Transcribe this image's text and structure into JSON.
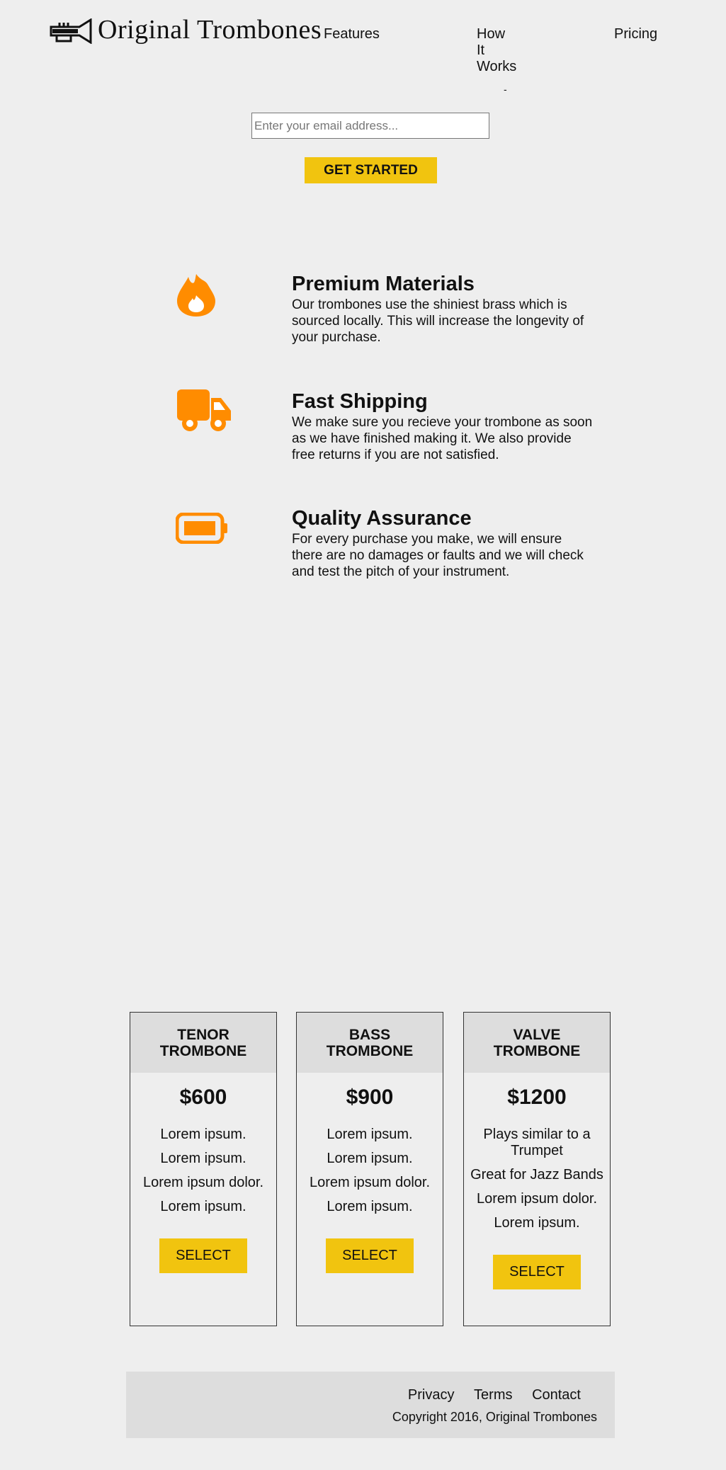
{
  "header": {
    "brand": "Original Trombones",
    "nav": [
      {
        "label": "Features"
      },
      {
        "label": "How It Works"
      },
      {
        "label": "Pricing"
      }
    ],
    "nav_marker": "-"
  },
  "hero": {
    "email_placeholder": "Enter your email address...",
    "email_value": "",
    "cta_label": "Get Started"
  },
  "features": [
    {
      "icon": "fire-icon",
      "title": "Premium Materials",
      "description": "Our trombones use the shiniest brass which is sourced locally. This will increase the longevity of your purchase."
    },
    {
      "icon": "truck-icon",
      "title": "Fast Shipping",
      "description": "We make sure you recieve your trombone as soon as we have finished making it. We also provide free returns if you are not satisfied."
    },
    {
      "icon": "battery-icon",
      "title": "Quality Assurance",
      "description": "For every purchase you make, we will ensure there are no damages or faults and we will check and test the pitch of your instrument."
    }
  ],
  "pricing": [
    {
      "name": "Tenor Trombone",
      "price": "$600",
      "features": [
        "Lorem ipsum.",
        "Lorem ipsum.",
        "Lorem ipsum dolor.",
        "Lorem ipsum."
      ],
      "button": "Select"
    },
    {
      "name": "Bass Trombone",
      "price": "$900",
      "features": [
        "Lorem ipsum.",
        "Lorem ipsum.",
        "Lorem ipsum dolor.",
        "Lorem ipsum."
      ],
      "button": "Select"
    },
    {
      "name": "Valve Trombone",
      "price": "$1200",
      "features": [
        "Plays similar to a Trumpet",
        "Great for Jazz Bands",
        "Lorem ipsum dolor.",
        "Lorem ipsum."
      ],
      "button": "Select"
    }
  ],
  "footer": {
    "links": [
      "Privacy",
      "Terms",
      "Contact"
    ],
    "copyright": "Copyright 2016, Original Trombones"
  },
  "colors": {
    "background": "#eeeeee",
    "accent_yellow": "#f1c40f",
    "icon_orange": "#ff8c00",
    "panel_gray": "#dddddd"
  }
}
